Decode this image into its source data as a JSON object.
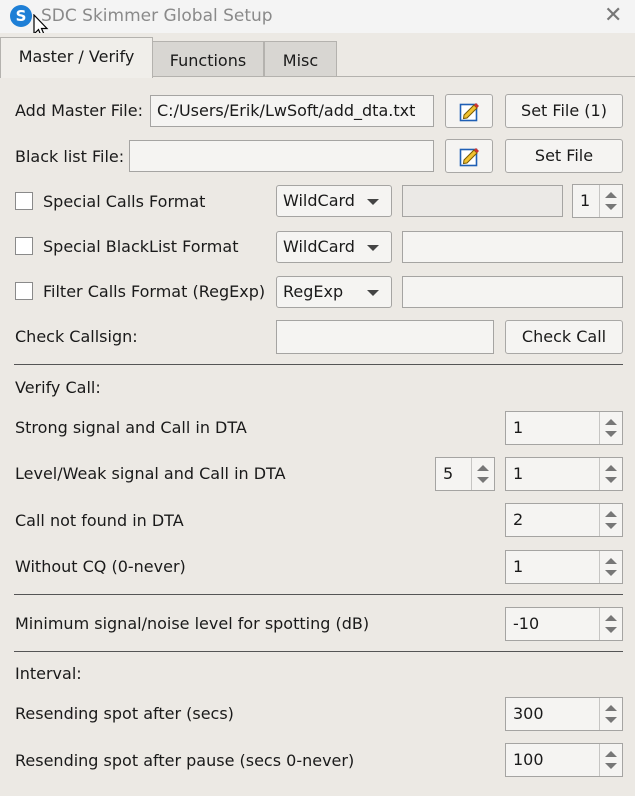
{
  "window": {
    "title": "SDC Skimmer Global Setup",
    "app_icon_letter": "S"
  },
  "tabs": [
    {
      "label": "Master / Verify"
    },
    {
      "label": "Functions"
    },
    {
      "label": "Misc"
    }
  ],
  "master": {
    "add_master_label": "Add Master File:",
    "add_master_value": "C:/Users/Erik/LwSoft/add_dta.txt",
    "set_file_1_label": "Set File (1)",
    "blacklist_label": "Black list File:",
    "blacklist_value": "",
    "set_file_label": "Set File",
    "special_calls_label": "Special Calls Format",
    "special_calls_mode": "WildCard",
    "special_calls_value": "",
    "special_calls_count": "1",
    "special_blacklist_label": "Special BlackList Format",
    "special_blacklist_mode": "WildCard",
    "special_blacklist_value": "",
    "filter_calls_label": "Filter Calls Format (RegExp)",
    "filter_calls_mode": "RegExp",
    "filter_calls_value": "",
    "check_callsign_label": "Check Callsign:",
    "check_callsign_value": "",
    "check_call_button": "Check Call"
  },
  "verify": {
    "heading": "Verify Call:",
    "strong_label": "Strong signal and Call in DTA",
    "strong_value": "1",
    "weak_label": "Level/Weak signal and Call in DTA",
    "weak_level": "5",
    "weak_value": "1",
    "notfound_label": "Call not found in DTA",
    "notfound_value": "2",
    "withoutcq_label": "Without CQ (0-never)",
    "withoutcq_value": "1"
  },
  "snr": {
    "label": "Minimum signal/noise level for spotting (dB)",
    "value": "-10"
  },
  "interval": {
    "heading": "Interval:",
    "resend_label": "Resending spot after (secs)",
    "resend_value": "300",
    "resend_pause_label": "Resending spot after pause (secs 0-never)",
    "resend_pause_value": "100"
  }
}
